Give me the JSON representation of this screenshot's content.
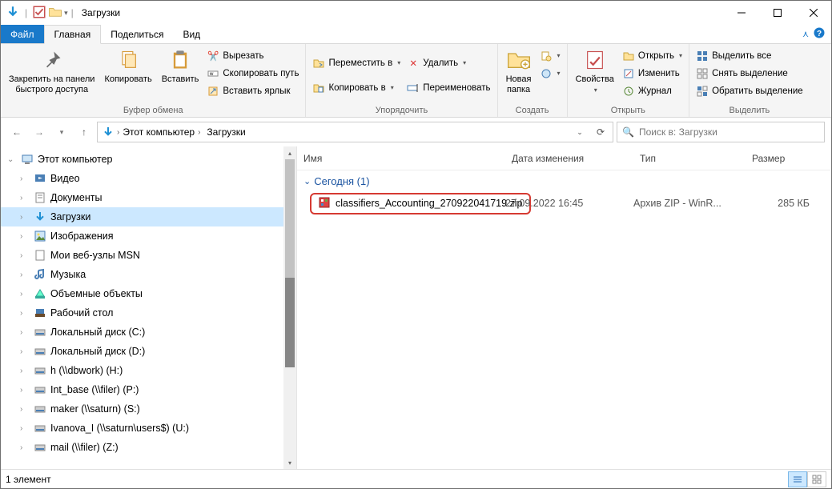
{
  "window": {
    "title": "Загрузки"
  },
  "tabs": {
    "file": "Файл",
    "home": "Главная",
    "share": "Поделиться",
    "view": "Вид"
  },
  "ribbon": {
    "pin": "Закрепить на панели\nбыстрого доступа",
    "copy": "Копировать",
    "paste": "Вставить",
    "cut": "Вырезать",
    "copypath": "Скопировать путь",
    "shortcut": "Вставить ярлык",
    "clipboard": "Буфер обмена",
    "moveto": "Переместить в",
    "copyto": "Копировать в",
    "delete": "Удалить",
    "rename": "Переименовать",
    "organize": "Упорядочить",
    "newfolder": "Новая\nпапка",
    "create": "Создать",
    "properties": "Свойства",
    "open": "Открыть",
    "edit": "Изменить",
    "history": "Журнал",
    "open_grp": "Открыть",
    "selall": "Выделить все",
    "selnone": "Снять выделение",
    "selinv": "Обратить выделение",
    "select": "Выделить"
  },
  "breadcrumb": {
    "pc": "Этот компьютер",
    "dl": "Загрузки"
  },
  "search": {
    "placeholder": "Поиск в: Загрузки"
  },
  "tree": {
    "pc": "Этот компьютер",
    "items": [
      "Видео",
      "Документы",
      "Загрузки",
      "Изображения",
      "Мои веб-узлы MSN",
      "Музыка",
      "Объемные объекты",
      "Рабочий стол",
      "Локальный диск (C:)",
      "Локальный диск (D:)",
      "h (\\\\dbwork) (H:)",
      "Int_base (\\\\filer) (P:)",
      "maker (\\\\saturn) (S:)",
      "Ivanova_I (\\\\saturn\\users$) (U:)",
      "mail (\\\\filer) (Z:)"
    ]
  },
  "columns": {
    "name": "Имя",
    "date": "Дата изменения",
    "type": "Тип",
    "size": "Размер"
  },
  "group": {
    "today": "Сегодня (1)"
  },
  "file": {
    "name": "classifiers_Accounting_270922041719.zip",
    "date": "27.09.2022 16:45",
    "type": "Архив ZIP - WinR...",
    "size": "285 КБ"
  },
  "status": {
    "count": "1 элемент"
  }
}
